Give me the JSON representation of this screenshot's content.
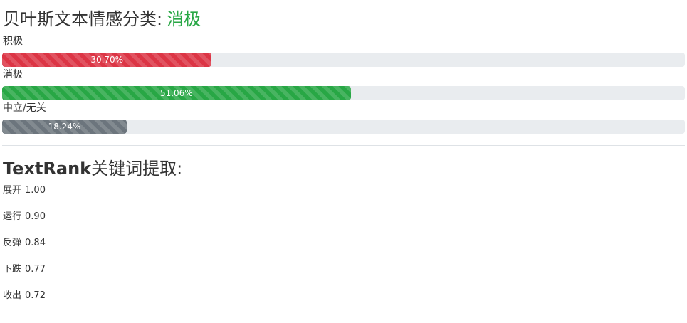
{
  "sentiment": {
    "title_prefix": "贝叶斯文本情感分类",
    "title_colon": ":",
    "result": "消极",
    "result_color": "#28a745",
    "categories": [
      {
        "label": "积极",
        "percent_text": "30.70%",
        "value": 30.7,
        "color": "#dc3545"
      },
      {
        "label": "消极",
        "percent_text": "51.06%",
        "value": 51.06,
        "color": "#28a745"
      },
      {
        "label": "中立/无关",
        "percent_text": "18.24%",
        "value": 18.24,
        "color": "#6c757d"
      }
    ]
  },
  "keywords": {
    "title_bold": "TextRank",
    "title_rest": "关键词提取:",
    "items": [
      {
        "word": "展开",
        "score": "1.00"
      },
      {
        "word": "运行",
        "score": "0.90"
      },
      {
        "word": "反弹",
        "score": "0.84"
      },
      {
        "word": "下跌",
        "score": "0.77"
      },
      {
        "word": "收出",
        "score": "0.72"
      }
    ]
  }
}
